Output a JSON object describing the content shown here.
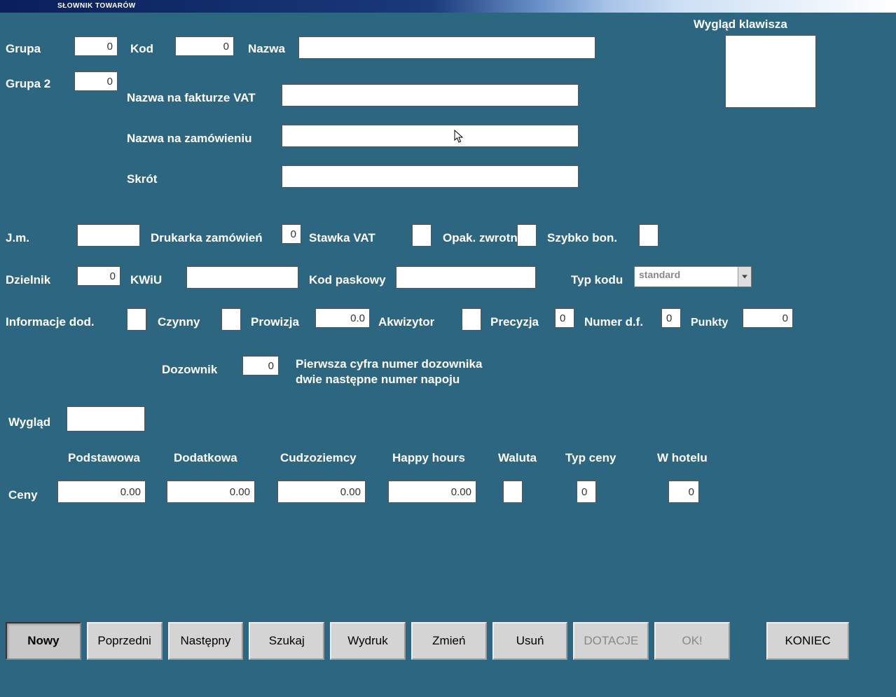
{
  "title": "SŁOWNIK TOWARÓW",
  "keylook_label": "Wygląd klawisza",
  "labels": {
    "grupa": "Grupa",
    "kod": "Kod",
    "nazwa": "Nazwa",
    "grupa2": "Grupa 2",
    "nazwa_faktura": "Nazwa na fakturze VAT",
    "nazwa_zamowienie": "Nazwa na zamówieniu",
    "skrot": "Skrót",
    "jm": "J.m.",
    "drukarka": "Drukarka zamówień",
    "stawka_vat": "Stawka VAT",
    "opak_zwrotne": "Opak. zwrotne",
    "szybko_bon": "Szybko bon.",
    "dzielnik": "Dzielnik",
    "kwiu": "KWiU",
    "kod_paskowy": "Kod paskowy",
    "typ_kodu": "Typ kodu",
    "info_dod": "Informacje dod.",
    "czynny": "Czynny",
    "prowizja": "Prowizja",
    "akwizytor": "Akwizytor",
    "precyzja": "Precyzja",
    "numer_df": "Numer d.f.",
    "punkty": "Punkty",
    "dozownik": "Dozownik",
    "dozownik_hint1": "Pierwsza cyfra numer dozownika",
    "dozownik_hint2": "dwie następne numer napoju",
    "wyglad": "Wygląd",
    "ceny": "Ceny"
  },
  "price_headers": {
    "podstawowa": "Podstawowa",
    "dodatkowa": "Dodatkowa",
    "cudzoziemcy": "Cudzoziemcy",
    "happy": "Happy hours",
    "waluta": "Waluta",
    "typ_ceny": "Typ ceny",
    "w_hotelu": "W hotelu"
  },
  "values": {
    "grupa": "0",
    "kod": "0",
    "grupa2": "0",
    "nazwa": "",
    "nazwa_faktura": "",
    "nazwa_zamowienie": "",
    "skrot": "",
    "jm": "",
    "drukarka": "0",
    "stawka_vat": "",
    "opak_zwrotne": "",
    "szybko_bon": "",
    "dzielnik": "0",
    "kwiu": "",
    "kod_paskowy": "",
    "typ_kodu": "standard",
    "info_dod": "",
    "czynny": "",
    "prowizja": "0.0",
    "akwizytor": "",
    "precyzja": "0",
    "numer_df": "0",
    "punkty": "0",
    "dozownik": "0",
    "wyglad": "",
    "cena_podstawowa": "0.00",
    "cena_dodatkowa": "0.00",
    "cena_cudzoziemcy": "0.00",
    "cena_happy": "0.00",
    "cena_waluta": "",
    "cena_typ": "0",
    "cena_hotel": "0"
  },
  "buttons": {
    "nowy": "Nowy",
    "poprzedni": "Poprzedni",
    "nastepny": "Następny",
    "szukaj": "Szukaj",
    "wydruk": "Wydruk",
    "zmien": "Zmień",
    "usun": "Usuń",
    "dotacje": "DOTACJE",
    "ok": "OK!",
    "koniec": "KONIEC"
  }
}
